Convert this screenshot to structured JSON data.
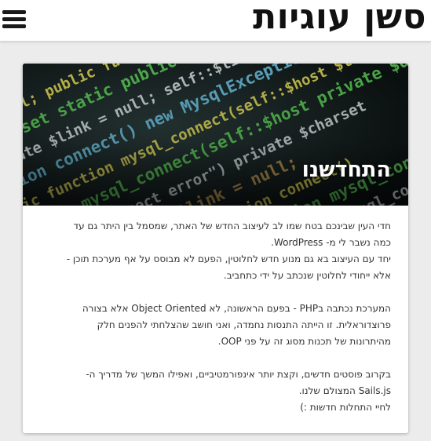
{
  "header": {
    "menu_icon": "hamburger-menu-icon",
    "site_title": "סשן עוגיות"
  },
  "post": {
    "hero_image": "code-screenshot-image",
    "title": "התחדשנו",
    "paragraphs": [
      [
        "חדי העין שבינכם בטח שמו לב לעיצוב החדש של האתר, שמסמל בין היתר גם עד כמה נשבר לי מ- WordPress.",
        "יחד עם העיצוב בא גם מנוע חדש לחלוטין, הפעם לא מבוסס על אף מערכת תוכן - אלא ייחודי לחלוטין שנכתב על ידי כתחביב."
      ],
      [
        "המערכת נכתבה בPHP - בפעם הראשונה, לא Object Oriented אלא בצורה פרוצדוראלית. זו הייתה התנסות נחמדה, ואני חושב שהצלחתי להפנים חלק מהיתרונות של תכנות מסוג זה על פני OOP."
      ],
      [
        "בקרוב פוסטים חדשים, וקצת יותר אינפורמטיביים, ואפילו המשך של מדריך ה- Sails.js המצולם שלנו.",
        "לחיי התחלות חדשות :)"
      ]
    ]
  },
  "hero_code_lines": [
    "private $db = null;",
    "private $charset",
    "static private $link = null;",
    "public function connect()",
    "static public function mysql_connect(self::$host",
    "self::$link = mysql_connect(self::$host",
    "new MysqlException(\"Connect error\")",
    "$link) {"
  ]
}
